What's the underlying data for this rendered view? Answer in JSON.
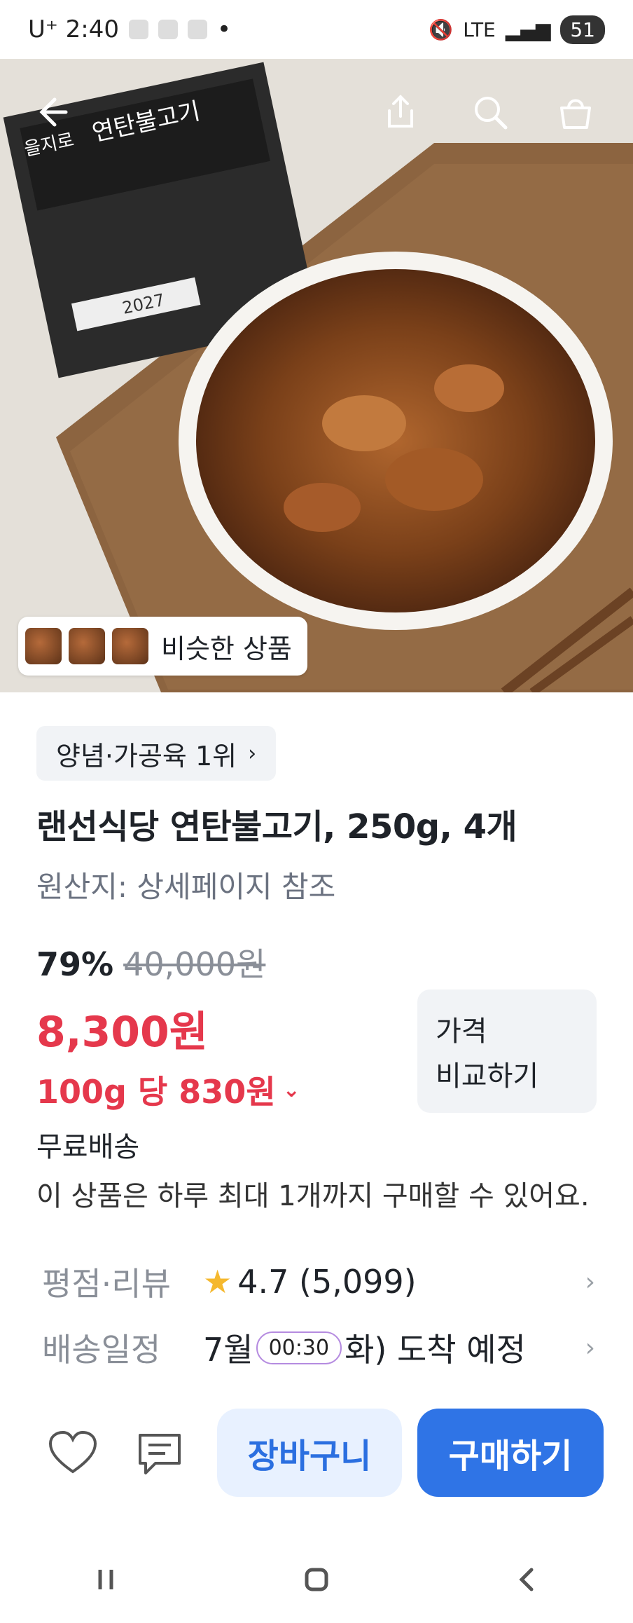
{
  "status_bar": {
    "carrier_time": "U⁺ 2:40",
    "network": "LTE",
    "battery": "51"
  },
  "hero": {
    "package_text": "연탄불고기",
    "package_brand": "을지로",
    "package_year": "2027",
    "similar_label": "비슷한 상품"
  },
  "product": {
    "rank_label": "양념·가공육 1위",
    "title": "랜선식당 연탄불고기, 250g, 4개",
    "origin": "원산지: 상세페이지 참조",
    "discount_rate": "79%",
    "original_price": "40,000원",
    "price": "8,300원",
    "unit_price": "100g 당 830원",
    "compare_label_line1": "가격",
    "compare_label_line2": "비교하기",
    "shipping": "무료배송",
    "purchase_limit": "이 상품은 하루 최대 1개까지 구매할 수 있어요.",
    "rating_label": "평점·리뷰",
    "rating_value": "4.7 (5,099)",
    "delivery_label": "배송일정",
    "delivery_month": "7월",
    "delivery_timer": "00:30",
    "delivery_suffix": "화) 도착 예정"
  },
  "actions": {
    "cart_label": "장바구니",
    "buy_label": "구매하기"
  },
  "colors": {
    "accent_red": "#e5384c",
    "accent_blue": "#2f74e6",
    "star": "#f5b82e"
  }
}
